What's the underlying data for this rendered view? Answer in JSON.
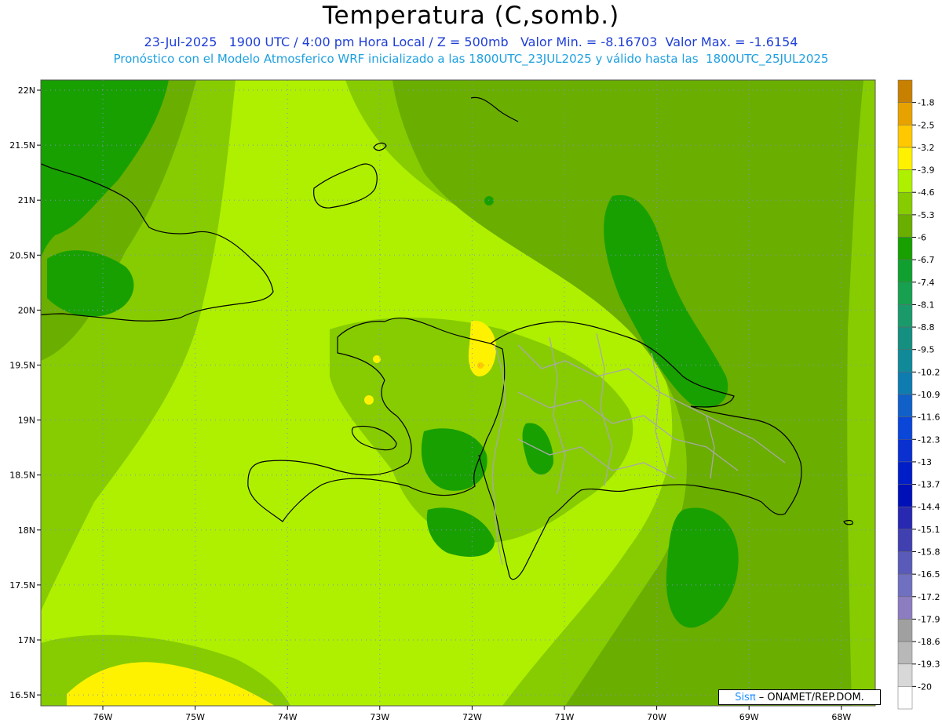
{
  "header": {
    "title": "Temperatura (C,somb.)",
    "line1": "23-Jul-2025   1900 UTC / 4:00 pm Hora Local / Z = 500mb   Valor Min. = -8.16703  Valor Max. = -1.6154",
    "line2": "Pronóstico con el Modelo Atmosferico WRF inicializado a las 1800UTC_23JUL2025 y válido hasta las  1800UTC_25JUL2025"
  },
  "axes": {
    "lat_labels": [
      "22N",
      "21.5N",
      "21N",
      "20.5N",
      "20N",
      "19.5N",
      "19N",
      "18.5N",
      "18N",
      "17.5N",
      "17N",
      "16.5N"
    ],
    "lon_labels": [
      "76W",
      "75W",
      "74W",
      "73W",
      "72W",
      "71W",
      "70W",
      "69W",
      "68W"
    ]
  },
  "legend": {
    "entries": [
      {
        "label": "-1.8",
        "color": "#c88000"
      },
      {
        "label": "-2.5",
        "color": "#e8a200"
      },
      {
        "label": "-3.2",
        "color": "#ffc800"
      },
      {
        "label": "-3.9",
        "color": "#fff200"
      },
      {
        "label": "-4.6",
        "color": "#aef000"
      },
      {
        "label": "-5.3",
        "color": "#86cc00"
      },
      {
        "label": "-6",
        "color": "#6aae00"
      },
      {
        "label": "-6.7",
        "color": "#18a000"
      },
      {
        "label": "-7.4",
        "color": "#10a030"
      },
      {
        "label": "-8.1",
        "color": "#16a050"
      },
      {
        "label": "-8.8",
        "color": "#1a9a6a"
      },
      {
        "label": "-9.5",
        "color": "#158f80"
      },
      {
        "label": "-10.2",
        "color": "#108a98"
      },
      {
        "label": "-10.9",
        "color": "#0f7cb0"
      },
      {
        "label": "-11.6",
        "color": "#1060c8"
      },
      {
        "label": "-12.3",
        "color": "#0a46d8"
      },
      {
        "label": "-13",
        "color": "#0a30d0"
      },
      {
        "label": "-13.7",
        "color": "#001ec8"
      },
      {
        "label": "-14.4",
        "color": "#0010b8"
      },
      {
        "label": "-15.1",
        "color": "#2828b0"
      },
      {
        "label": "-15.8",
        "color": "#4040b0"
      },
      {
        "label": "-16.5",
        "color": "#5a5ab8"
      },
      {
        "label": "-17.2",
        "color": "#7070c0"
      },
      {
        "label": "-17.9",
        "color": "#8c7cc0"
      },
      {
        "label": "-18.6",
        "color": "#a0a0a0"
      },
      {
        "label": "-19.3",
        "color": "#b8b8b8"
      },
      {
        "label": "-20",
        "color": "#d8d8d8"
      }
    ]
  },
  "credit": {
    "sis": "Sisπ",
    "org": " – ONAMET/REP.DOM."
  },
  "colors": {
    "field_base": "#aef000",
    "field_mid": "#86cc00",
    "field_dark": "#6aae00",
    "field_deep": "#18a000",
    "coast": "#000000",
    "provinces": "#a8a8a8",
    "grid": "#8a8acc"
  }
}
